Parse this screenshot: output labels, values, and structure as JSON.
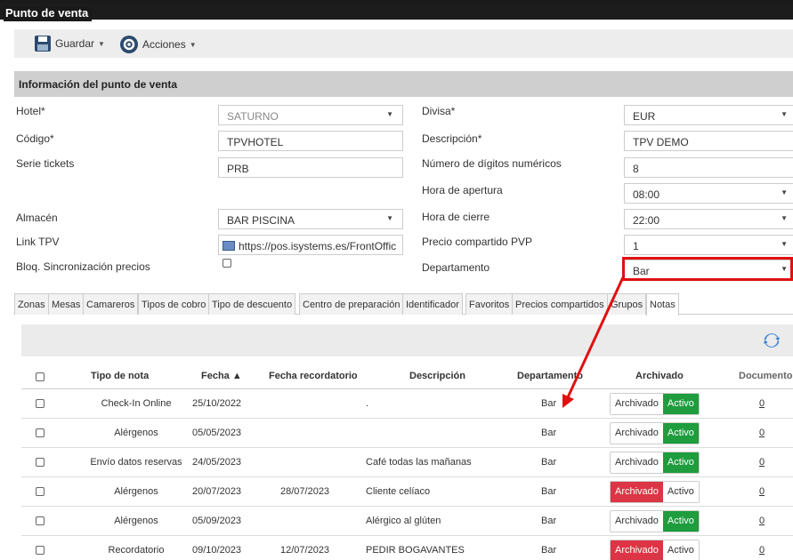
{
  "window": {
    "title": "Punto de venta"
  },
  "toolbar": {
    "save_label": "Guardar",
    "actions_label": "Acciones"
  },
  "section": {
    "title": "Información del punto de venta"
  },
  "form": {
    "hotel_label": "Hotel*",
    "hotel_value": "SATURNO",
    "codigo_label": "Código*",
    "codigo_value": "TPVHOTEL",
    "serie_label": "Serie tickets",
    "serie_value": "PRB",
    "almacen_label": "Almacén",
    "almacen_value": "BAR PISCINA",
    "link_label": "Link TPV",
    "link_value": "https://pos.isystems.es/FrontOffic",
    "bloq_label": "Bloq. Sincronización precios",
    "divisa_label": "Divisa*",
    "divisa_value": "EUR",
    "descripcion_label": "Descripción*",
    "descripcion_value": "TPV DEMO",
    "digitos_label": "Número de dígitos numéricos",
    "digitos_value": "8",
    "apertura_label": "Hora de apertura",
    "apertura_value": "08:00",
    "cierre_label": "Hora de cierre",
    "cierre_value": "22:00",
    "pvp_label": "Precio compartido PVP",
    "pvp_value": "1",
    "departamento_label": "Departamento",
    "departamento_value": "Bar"
  },
  "tabs": [
    "Zonas",
    "Mesas",
    "Camareros",
    "Tipos de cobro",
    "Tipo de descuento",
    "Centro de preparación",
    "Identificador",
    "Favoritos",
    "Precios compartidos",
    "Grupos",
    "Notas"
  ],
  "table": {
    "headers": {
      "tipo": "Tipo de nota",
      "fecha": "Fecha ▲",
      "recordatorio": "Fecha recordatorio",
      "descripcion": "Descripción",
      "departamento": "Departamento",
      "archivado": "Archivado",
      "documentos": "Documentos"
    },
    "toggle_archived": "Archivado",
    "toggle_active": "Activo",
    "rows": [
      {
        "tipo": "Check-In Online",
        "fecha": "25/10/2022",
        "recordatorio": "",
        "descripcion": ".",
        "departamento": "Bar",
        "state": "activo",
        "docs": "0"
      },
      {
        "tipo": "Alérgenos",
        "fecha": "05/05/2023",
        "recordatorio": "",
        "descripcion": "",
        "departamento": "Bar",
        "state": "activo",
        "docs": "0"
      },
      {
        "tipo": "Envío datos reservas",
        "fecha": "24/05/2023",
        "recordatorio": "",
        "descripcion": "Café todas las mañanas",
        "departamento": "Bar",
        "state": "activo",
        "docs": "0"
      },
      {
        "tipo": "Alérgenos",
        "fecha": "20/07/2023",
        "recordatorio": "28/07/2023",
        "descripcion": "Cliente celíaco",
        "departamento": "Bar",
        "state": "archivado",
        "docs": "0"
      },
      {
        "tipo": "Alérgenos",
        "fecha": "05/09/2023",
        "recordatorio": "",
        "descripcion": "Alérgico al glúten",
        "departamento": "Bar",
        "state": "activo",
        "docs": "0"
      },
      {
        "tipo": "Recordatorio",
        "fecha": "09/10/2023",
        "recordatorio": "12/07/2023",
        "descripcion": "PEDIR BOGAVANTES",
        "departamento": "Bar",
        "state": "archivado",
        "docs": "0"
      }
    ]
  },
  "colors": {
    "active_green": "#1e9c3e",
    "archived_red": "#dc3545",
    "highlight_red": "#e01010"
  }
}
